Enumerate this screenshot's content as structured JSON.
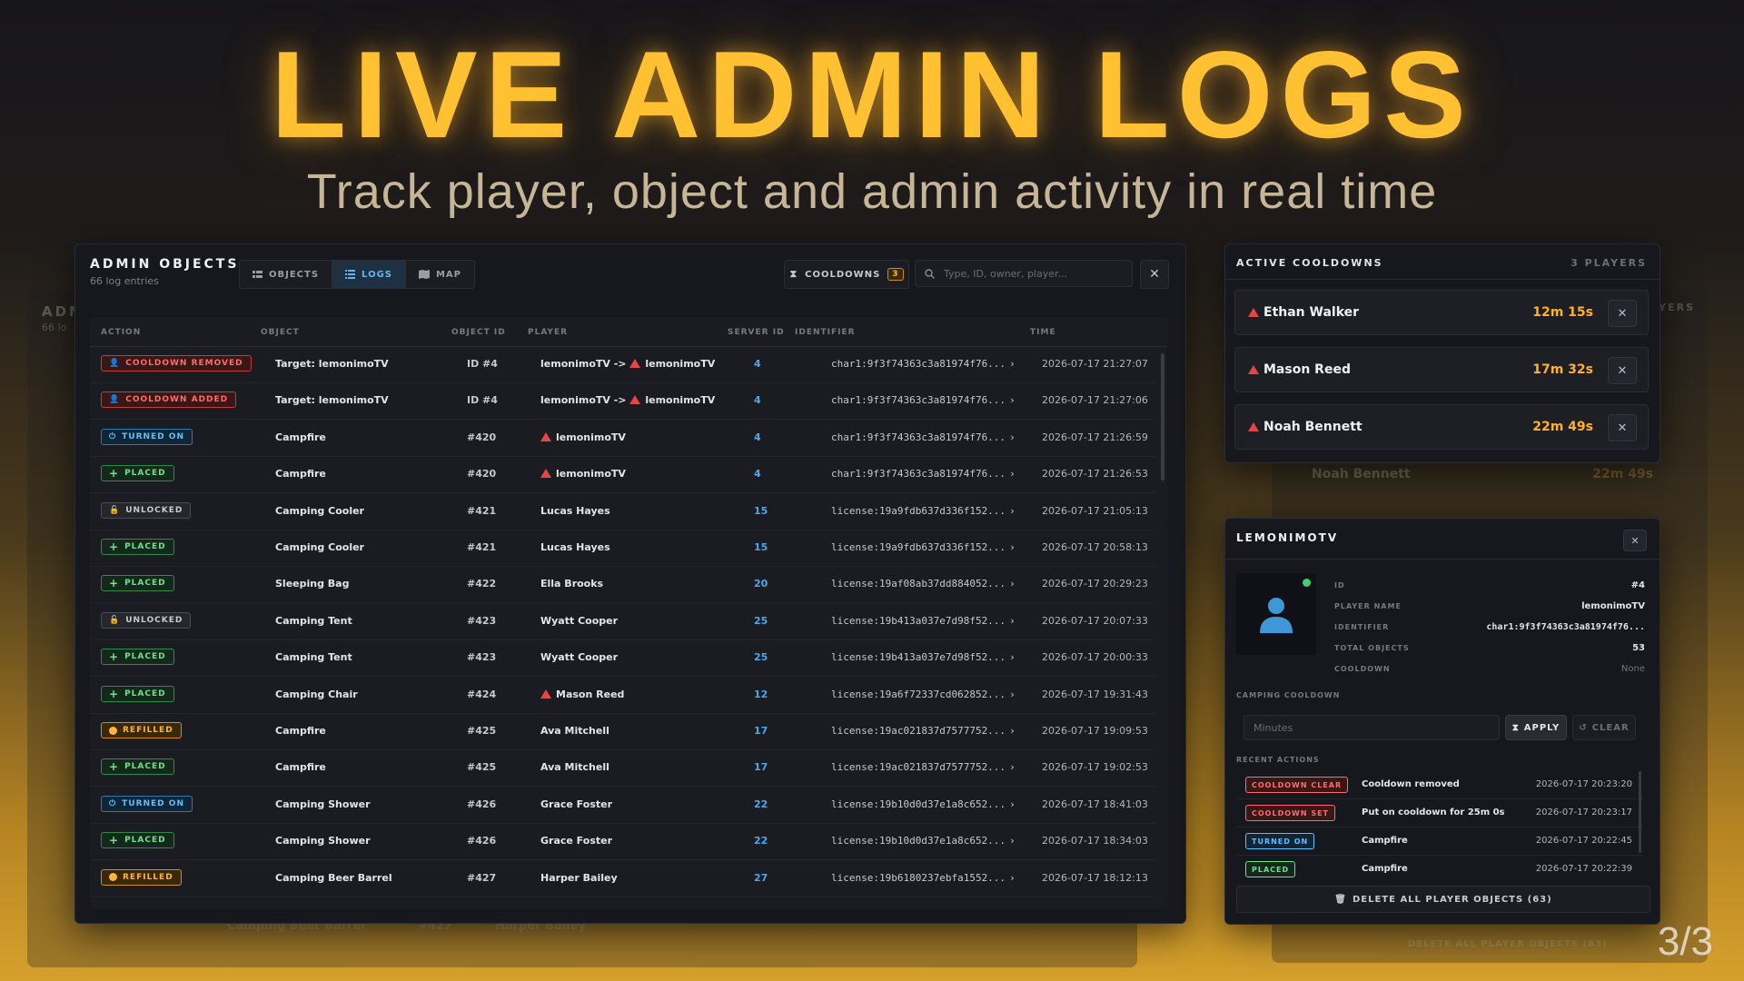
{
  "hero": {
    "title": "LIVE ADMIN LOGS",
    "subtitle": "Track player, object and admin activity in real time",
    "page": "3/3"
  },
  "main": {
    "title": "ADMIN OBJECTS",
    "subtitle": "66 log entries",
    "tabs": [
      {
        "label": "OBJECTS",
        "icon": "grid-icon"
      },
      {
        "label": "LOGS",
        "icon": "list-icon",
        "active": true
      },
      {
        "label": "MAP",
        "icon": "map-icon"
      }
    ],
    "cooldowns_label": "COOLDOWNS",
    "cooldowns_count": "3",
    "search_placeholder": "Type, ID, owner, player...",
    "columns": [
      "ACTION",
      "OBJECT",
      "OBJECT ID",
      "PLAYER",
      "SERVER ID",
      "IDENTIFIER",
      "TIME"
    ],
    "rows": [
      {
        "action": "COOLDOWN REMOVED",
        "type": "red",
        "object": "Target: lemonimoTV",
        "object_id": "ID #4",
        "player": "lemonimoTV ->",
        "target": "lemonimoTV",
        "player_warn": false,
        "server": "4",
        "ident": "char1:9f3f74363c3a81974f76...",
        "time": "2026-07-17 21:27:07"
      },
      {
        "action": "COOLDOWN ADDED",
        "type": "red",
        "object": "Target: lemonimoTV",
        "object_id": "ID #4",
        "player": "lemonimoTV ->",
        "target": "lemonimoTV",
        "player_warn": false,
        "server": "4",
        "ident": "char1:9f3f74363c3a81974f76...",
        "time": "2026-07-17 21:27:06"
      },
      {
        "action": "TURNED ON",
        "type": "blue",
        "object": "Campfire",
        "object_id": "#420",
        "player": "lemonimoTV",
        "player_warn": true,
        "server": "4",
        "ident": "char1:9f3f74363c3a81974f76...",
        "time": "2026-07-17 21:26:59"
      },
      {
        "action": "PLACED",
        "type": "green",
        "object": "Campfire",
        "object_id": "#420",
        "player": "lemonimoTV",
        "player_warn": true,
        "server": "4",
        "ident": "char1:9f3f74363c3a81974f76...",
        "time": "2026-07-17 21:26:53"
      },
      {
        "action": "UNLOCKED",
        "type": "gray",
        "object": "Camping Cooler",
        "object_id": "#421",
        "player": "Lucas Hayes",
        "player_warn": false,
        "server": "15",
        "ident": "license:19a9fdb637d336f152...",
        "time": "2026-07-17 21:05:13"
      },
      {
        "action": "PLACED",
        "type": "green",
        "object": "Camping Cooler",
        "object_id": "#421",
        "player": "Lucas Hayes",
        "player_warn": false,
        "server": "15",
        "ident": "license:19a9fdb637d336f152...",
        "time": "2026-07-17 20:58:13"
      },
      {
        "action": "PLACED",
        "type": "green",
        "object": "Sleeping Bag",
        "object_id": "#422",
        "player": "Ella Brooks",
        "player_warn": false,
        "server": "20",
        "ident": "license:19af08ab37dd884052...",
        "time": "2026-07-17 20:29:23"
      },
      {
        "action": "UNLOCKED",
        "type": "gray",
        "object": "Camping Tent",
        "object_id": "#423",
        "player": "Wyatt Cooper",
        "player_warn": false,
        "server": "25",
        "ident": "license:19b413a037e7d98f52...",
        "time": "2026-07-17 20:07:33"
      },
      {
        "action": "PLACED",
        "type": "green",
        "object": "Camping Tent",
        "object_id": "#423",
        "player": "Wyatt Cooper",
        "player_warn": false,
        "server": "25",
        "ident": "license:19b413a037e7d98f52...",
        "time": "2026-07-17 20:00:33"
      },
      {
        "action": "PLACED",
        "type": "green",
        "object": "Camping Chair",
        "object_id": "#424",
        "player": "Mason Reed",
        "player_warn": true,
        "server": "12",
        "ident": "license:19a6f72337cd062852...",
        "time": "2026-07-17 19:31:43"
      },
      {
        "action": "REFILLED",
        "type": "orange",
        "object": "Campfire",
        "object_id": "#425",
        "player": "Ava Mitchell",
        "player_warn": false,
        "server": "17",
        "ident": "license:19ac021837d7577752...",
        "time": "2026-07-17 19:09:53"
      },
      {
        "action": "PLACED",
        "type": "green",
        "object": "Campfire",
        "object_id": "#425",
        "player": "Ava Mitchell",
        "player_warn": false,
        "server": "17",
        "ident": "license:19ac021837d7577752...",
        "time": "2026-07-17 19:02:53"
      },
      {
        "action": "TURNED ON",
        "type": "blue",
        "object": "Camping Shower",
        "object_id": "#426",
        "player": "Grace Foster",
        "player_warn": false,
        "server": "22",
        "ident": "license:19b10d0d37e1a8c652...",
        "time": "2026-07-17 18:41:03"
      },
      {
        "action": "PLACED",
        "type": "green",
        "object": "Camping Shower",
        "object_id": "#426",
        "player": "Grace Foster",
        "player_warn": false,
        "server": "22",
        "ident": "license:19b10d0d37e1a8c652...",
        "time": "2026-07-17 18:34:03"
      },
      {
        "action": "REFILLED",
        "type": "orange",
        "object": "Camping Beer Barrel",
        "object_id": "#427",
        "player": "Harper Bailey",
        "player_warn": false,
        "server": "27",
        "ident": "license:19b6180237ebfa1552...",
        "time": "2026-07-17 18:12:13"
      }
    ]
  },
  "cooldowns": {
    "title": "ACTIVE COOLDOWNS",
    "count": "3 PLAYERS",
    "items": [
      {
        "name": "Ethan Walker",
        "time": "12m 15s"
      },
      {
        "name": "Mason Reed",
        "time": "17m 32s"
      },
      {
        "name": "Noah Bennett",
        "time": "22m 49s"
      }
    ]
  },
  "ghost": {
    "left_title": "ADM",
    "left_sub": "66 lo",
    "right_header": "YERS",
    "right_name": "Noah Bennett",
    "right_time": "22m 49s",
    "bottom_object": "Camping Beer Barrel",
    "bottom_id": "#427",
    "bottom_player": "Harper Bailey",
    "bottom_delete": "DELETE ALL PLAYER OBJECTS (63)"
  },
  "player": {
    "title": "LEMONIMOTV",
    "fields": [
      {
        "label": "ID",
        "value": "#4"
      },
      {
        "label": "PLAYER NAME",
        "value": "lemonimoTV"
      },
      {
        "label": "IDENTIFIER",
        "value": "char1:9f3f74363c3a81974f76..."
      },
      {
        "label": "TOTAL OBJECTS",
        "value": "53"
      },
      {
        "label": "COOLDOWN",
        "value": "None"
      }
    ],
    "camping_label": "CAMPING COOLDOWN",
    "minutes_placeholder": "Minutes",
    "apply_label": "APPLY",
    "clear_label": "CLEAR",
    "recent_label": "RECENT ACTIONS",
    "recent": [
      {
        "badge": "COOLDOWN CLEAR",
        "type": "red",
        "text": "Cooldown removed",
        "time": "2026-07-17 20:23:20"
      },
      {
        "badge": "COOLDOWN SET",
        "type": "red",
        "text": "Put on cooldown for 25m 0s",
        "time": "2026-07-17 20:23:17"
      },
      {
        "badge": "TURNED ON",
        "type": "blue",
        "text": "Campfire",
        "time": "2026-07-17 20:22:45"
      },
      {
        "badge": "PLACED",
        "type": "green",
        "text": "Campfire",
        "time": "2026-07-17 20:22:39"
      }
    ],
    "delete_label": "DELETE ALL PLAYER OBJECTS (63)"
  },
  "colors": {
    "accent": "#ffc132",
    "link": "#4aa8ee",
    "warn": "#e64545",
    "timer": "#ffb12a"
  }
}
